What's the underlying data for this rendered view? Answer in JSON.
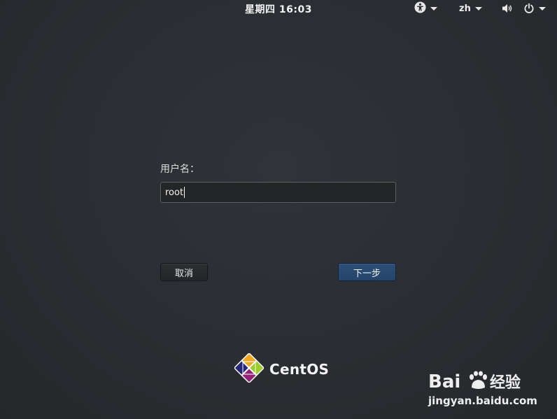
{
  "topbar": {
    "clock": "星期四 16:03",
    "language": "zh",
    "icons": [
      "accessibility-icon",
      "volume-icon",
      "power-icon"
    ]
  },
  "login": {
    "username_label": "用户名：",
    "username_value": "root",
    "cancel_label": "取消",
    "next_label": "下一步"
  },
  "branding": {
    "name": "CentOS"
  },
  "watermark": {
    "brand": "Baidu经验",
    "url": "jingyan.baidu.com"
  },
  "colors": {
    "background": "#2a2d31",
    "next_button": "#2d4f78",
    "input_bg": "#242527"
  }
}
